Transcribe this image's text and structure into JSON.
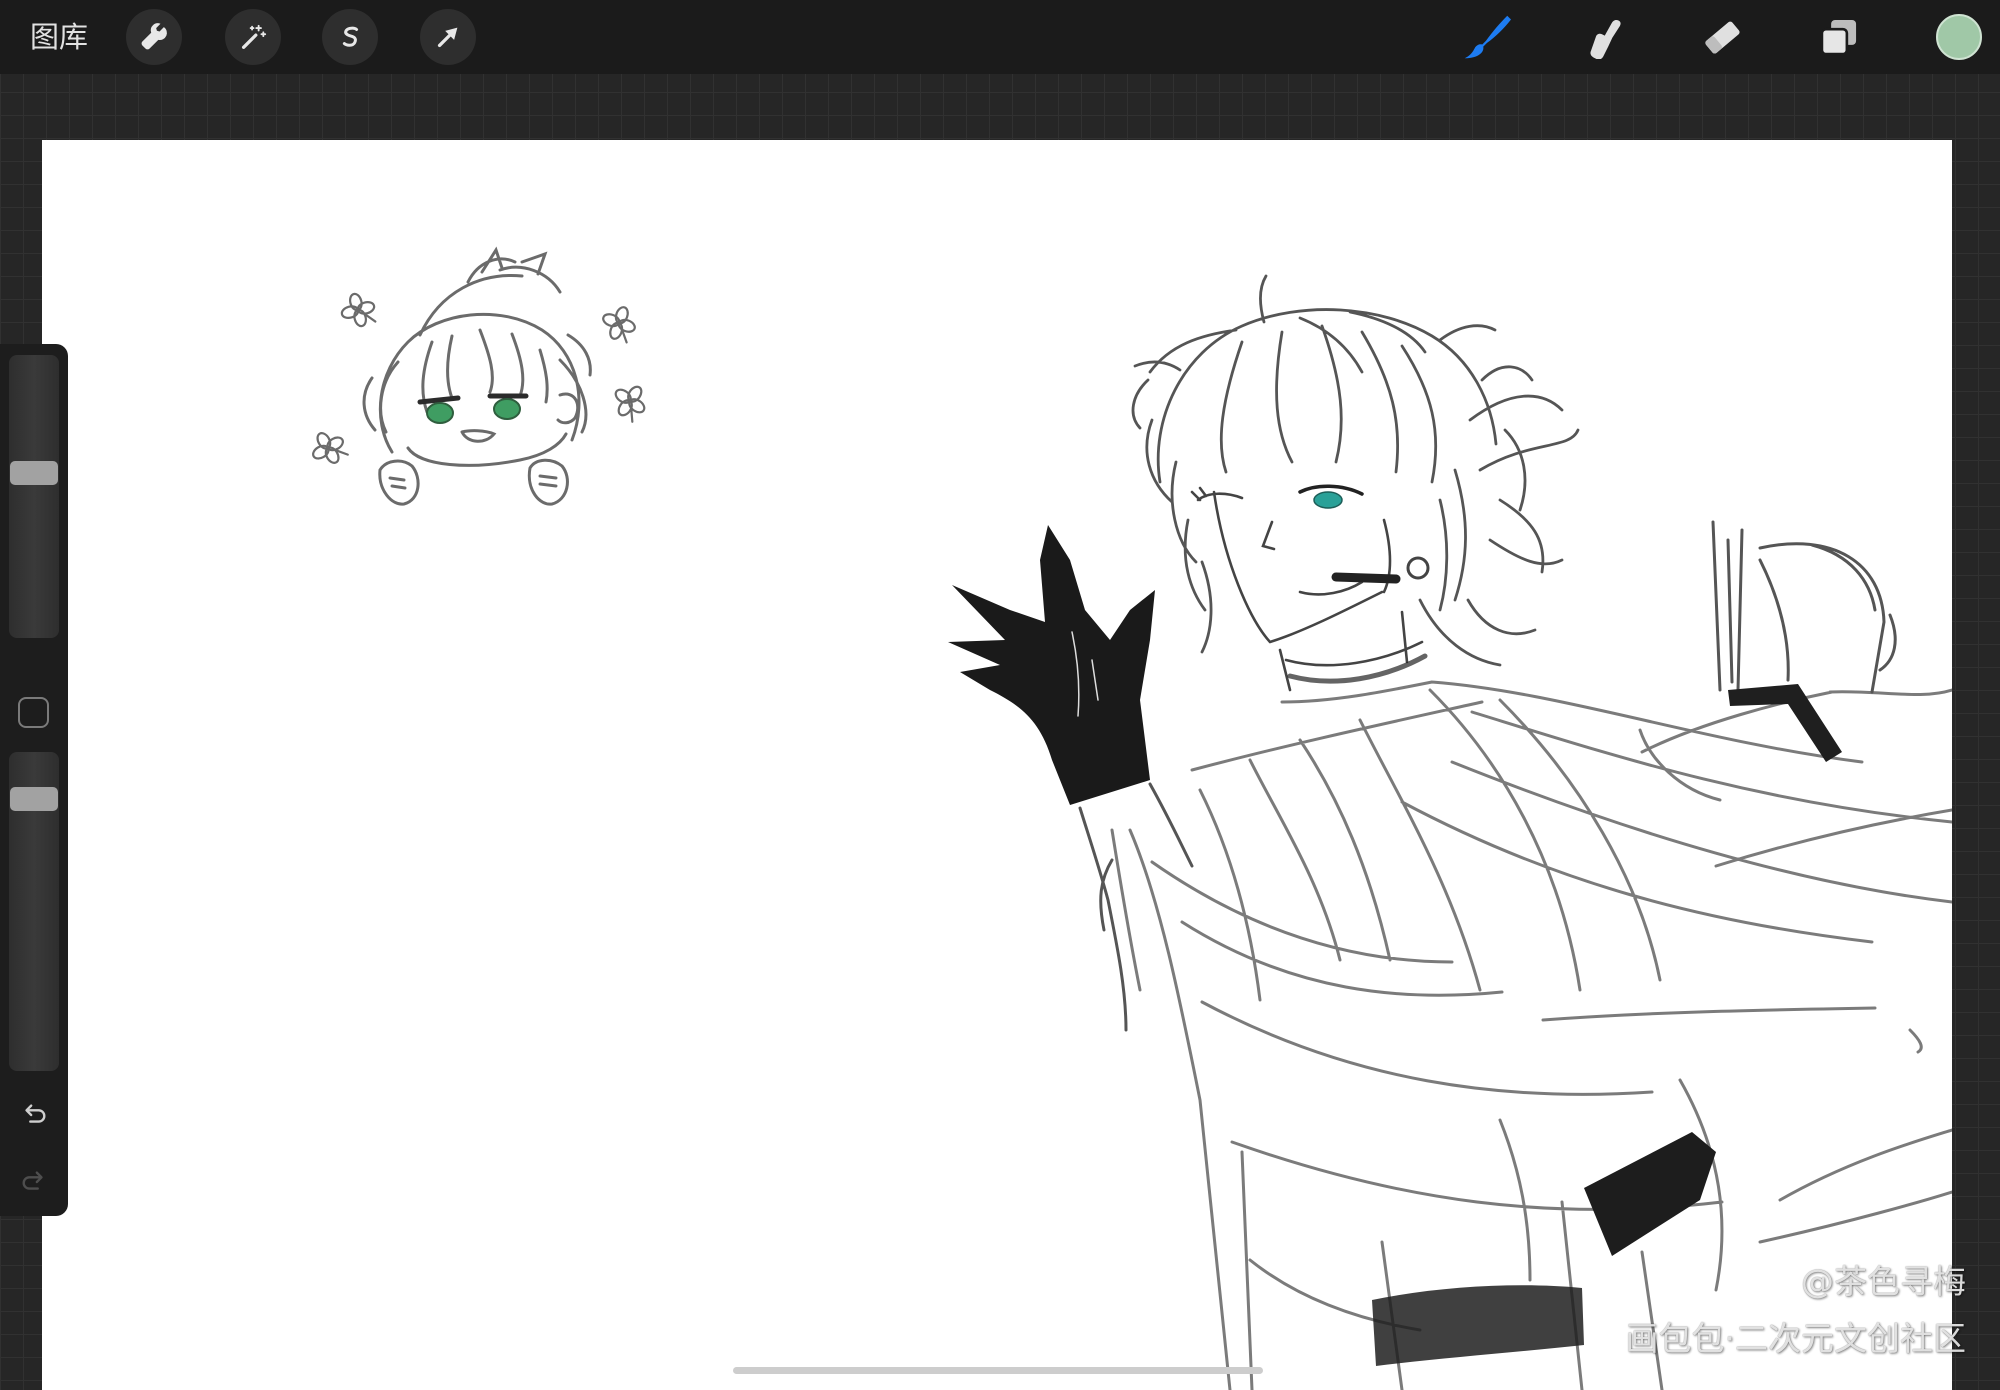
{
  "toolbar": {
    "gallery_label": "图库",
    "left_tools": [
      {
        "icon": "wrench-icon"
      },
      {
        "icon": "magic-wand-icon"
      },
      {
        "icon": "selection-icon"
      },
      {
        "icon": "transform-arrow-icon"
      }
    ],
    "right_tools": [
      {
        "icon": "brush-icon",
        "active": true
      },
      {
        "icon": "smudge-icon"
      },
      {
        "icon": "eraser-icon"
      },
      {
        "icon": "layers-icon"
      },
      {
        "icon": "color-swatch"
      }
    ],
    "active_tool_color": "#1d7cf2",
    "current_color": "#a0c8a7"
  },
  "sidebar": {
    "brush_size_level": 0.59,
    "opacity_level": 0.88,
    "icons": {
      "modify": "square-icon",
      "undo": "undo-icon",
      "redo": "redo-icon"
    }
  },
  "canvas": {
    "background": "#ffffff"
  },
  "watermark": {
    "handle": "@茶色寻梅",
    "site": "画包包·二次元文创社区"
  }
}
